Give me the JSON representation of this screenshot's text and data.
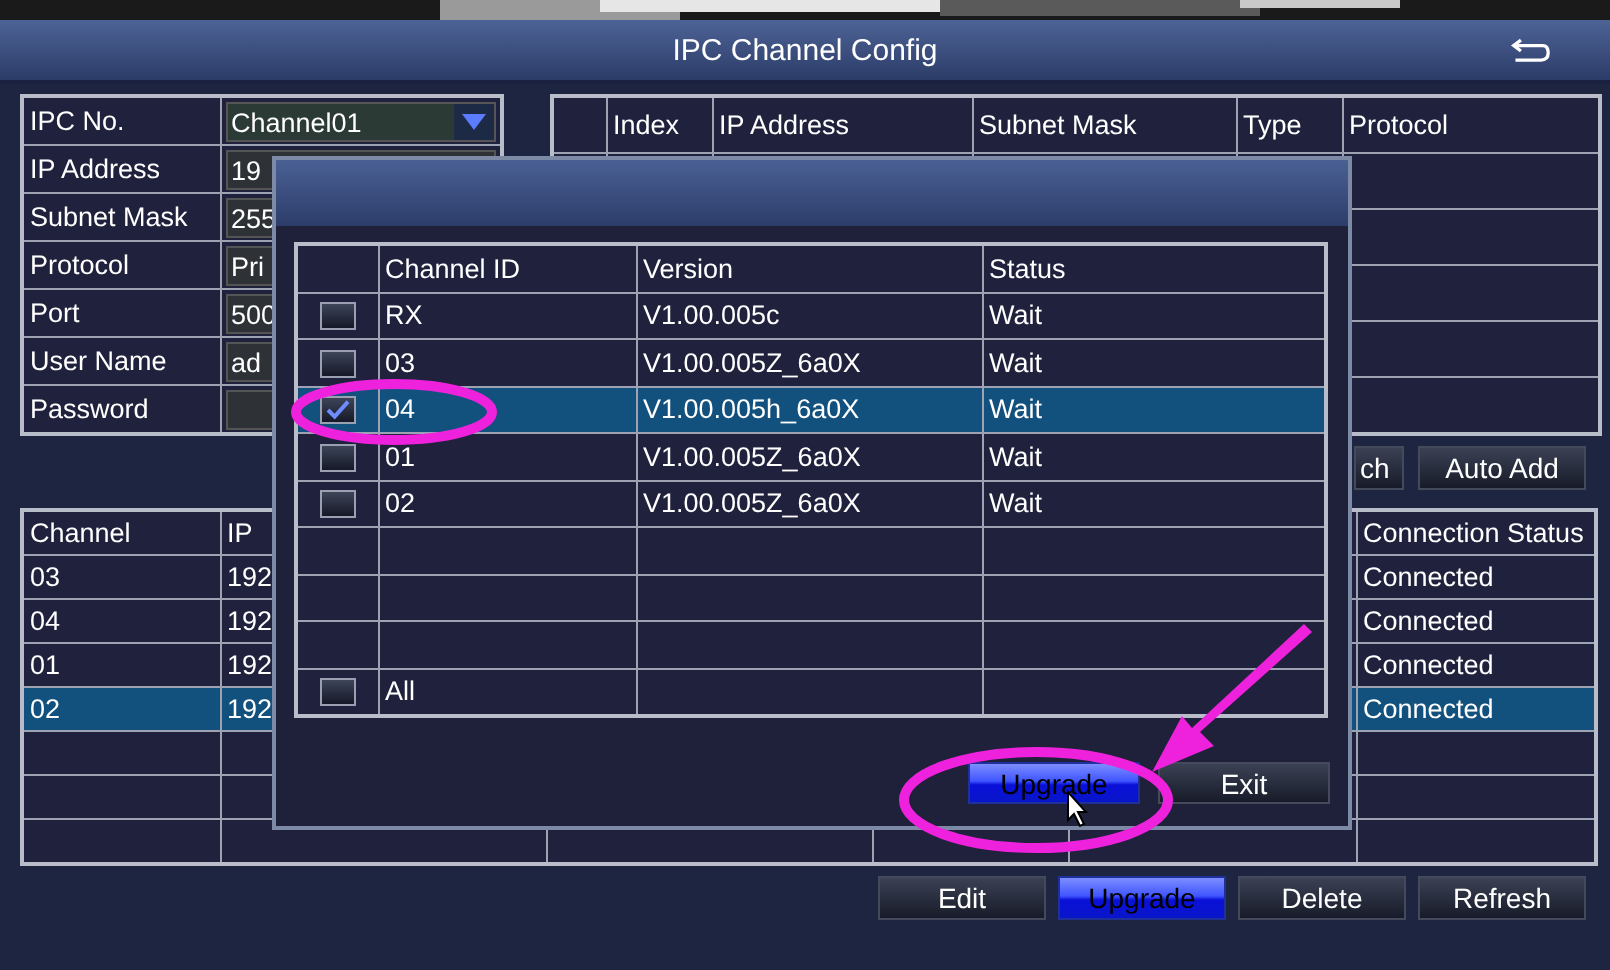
{
  "window": {
    "title": "IPC Channel Config"
  },
  "ipc_form": [
    {
      "label": "IPC No.",
      "value": "Channel01",
      "kind": "dropdown"
    },
    {
      "label": "IP Address",
      "value": "19",
      "kind": "text"
    },
    {
      "label": "Subnet Mask",
      "value": "255",
      "kind": "text"
    },
    {
      "label": "Protocol",
      "value": "Pri",
      "kind": "text"
    },
    {
      "label": "Port",
      "value": "500",
      "kind": "text"
    },
    {
      "label": "User Name",
      "value": "ad",
      "kind": "text"
    },
    {
      "label": "Password",
      "kind": "password"
    }
  ],
  "device_table": {
    "columns": [
      "Index",
      "IP Address",
      "Subnet Mask",
      "Type",
      "Protocol"
    ]
  },
  "search_buttons": [
    "ch",
    "Auto Add"
  ],
  "channel_table": {
    "columns": [
      "Channel",
      "IP",
      "Connection Status"
    ],
    "rows": [
      {
        "channel": "03",
        "ip": "192",
        "status": "Connected",
        "selected": false
      },
      {
        "channel": "04",
        "ip": "192",
        "status": "Connected",
        "selected": false
      },
      {
        "channel": "01",
        "ip": "192",
        "status": "Connected",
        "selected": false
      },
      {
        "channel": "02",
        "ip": "192",
        "status": "Connected",
        "selected": true
      }
    ]
  },
  "actions": [
    {
      "label": "Edit",
      "highlighted": false
    },
    {
      "label": "Upgrade",
      "highlighted": true
    },
    {
      "label": "Delete",
      "highlighted": false
    },
    {
      "label": "Refresh",
      "highlighted": false
    }
  ],
  "upgrade_dialog": {
    "columns": [
      "Channel ID",
      "Version",
      "Status"
    ],
    "rows": [
      {
        "channel_id": "RX",
        "version": "V1.00.005c",
        "status": "Wait",
        "checked": false,
        "selected": false
      },
      {
        "channel_id": "03",
        "version": "V1.00.005Z_6a0X",
        "status": "Wait",
        "checked": false,
        "selected": false
      },
      {
        "channel_id": "04",
        "version": "V1.00.005h_6a0X",
        "status": "Wait",
        "checked": true,
        "selected": true
      },
      {
        "channel_id": "01",
        "version": "V1.00.005Z_6a0X",
        "status": "Wait",
        "checked": false,
        "selected": false
      },
      {
        "channel_id": "02",
        "version": "V1.00.005Z_6a0X",
        "status": "Wait",
        "checked": false,
        "selected": false
      }
    ],
    "select_all": {
      "label": "All",
      "checked": false
    },
    "buttons": [
      {
        "label": "Upgrade",
        "highlighted": true
      },
      {
        "label": "Exit",
        "highlighted": false
      }
    ]
  }
}
